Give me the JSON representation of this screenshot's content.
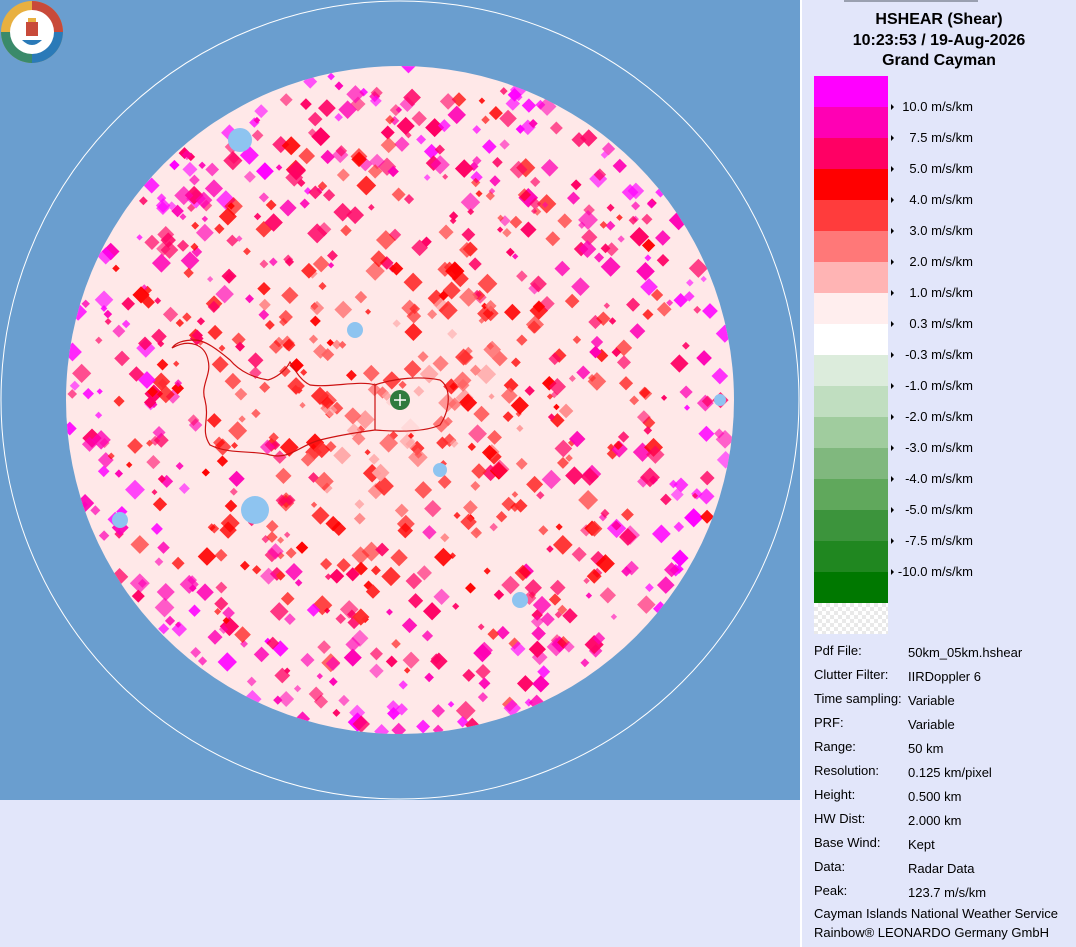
{
  "header": {
    "product": "HSHEAR (Shear)",
    "datetime": "10:23:53 / 19-Aug-2026",
    "site": "Grand Cayman"
  },
  "legend": {
    "colors": [
      "#ff00ff",
      "#ff00b4",
      "#ff0064",
      "#ff0000",
      "#ff3c3c",
      "#ff7878",
      "#ffb4b4",
      "#ffeeee",
      "#ffffff",
      "#dcecdc",
      "#c0dec0",
      "#a0cc9e",
      "#80b87e",
      "#60a85c",
      "#3c943c",
      "#208720",
      "#007800",
      "checker"
    ],
    "labels": [
      "10.0 m/s/km",
      "7.5 m/s/km",
      "5.0 m/s/km",
      "4.0 m/s/km",
      "3.0 m/s/km",
      "2.0 m/s/km",
      "1.0 m/s/km",
      "0.3 m/s/km",
      "-0.3 m/s/km",
      "-1.0 m/s/km",
      "-2.0 m/s/km",
      "-3.0 m/s/km",
      "-4.0 m/s/km",
      "-5.0 m/s/km",
      "-7.5 m/s/km",
      "-10.0 m/s/km"
    ]
  },
  "info": [
    {
      "label": "Pdf File:",
      "value": "50km_05km.hshear"
    },
    {
      "label": "Clutter Filter:",
      "value": "IIRDoppler 6"
    },
    {
      "label": "Time sampling:",
      "value": "Variable"
    },
    {
      "label": "PRF:",
      "value": "Variable"
    },
    {
      "label": "Range:",
      "value": "50 km"
    },
    {
      "label": "Resolution:",
      "value": "0.125 km/pixel"
    },
    {
      "label": "Height:",
      "value": "0.500 km"
    },
    {
      "label": "HW Dist:",
      "value": "2.000 km"
    },
    {
      "label": "Base Wind:",
      "value": "Kept"
    },
    {
      "label": "Data:",
      "value": "Radar Data"
    },
    {
      "label": "Peak:",
      "value": "123.7 m/s/km"
    }
  ],
  "footer": {
    "line1": "Cayman Islands National Weather Service",
    "line2": "Rainbow® LEONARDO Germany GmbH"
  },
  "map": {
    "background_color": "#6a9ecf",
    "data_disk_base": "#ffe6e6"
  }
}
